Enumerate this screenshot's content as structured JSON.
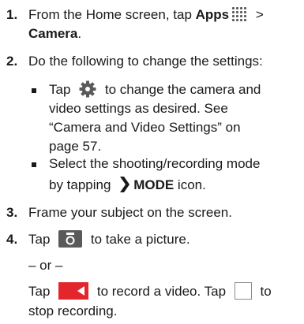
{
  "step1": {
    "number": "1.",
    "text_a": "From the Home screen, tap ",
    "apps": "Apps",
    "text_b": " >",
    "camera": "Camera",
    "text_c": "."
  },
  "step2": {
    "number": "2.",
    "text": "Do the following to change the settings:",
    "bullet1": {
      "text_a": "Tap ",
      "text_b": " to change the camera and",
      "line2": "video settings as desired. See",
      "line3": "“Camera and Video Settings” on",
      "line4": "page 57."
    },
    "bullet2": {
      "line1": "Select the shooting/recording mode",
      "text_a": "by tapping ",
      "mode": "MODE",
      "text_b": " icon."
    }
  },
  "step3": {
    "number": "3.",
    "text": "Frame your subject on the screen."
  },
  "step4": {
    "number": "4.",
    "text_a": "Tap ",
    "text_b": " to take a picture.",
    "or": "– or –",
    "video_a": "Tap ",
    "video_b": " to record a video. Tap ",
    "video_c": " to",
    "video_line2": "stop recording."
  },
  "icons": {
    "apps": "apps-grid-icon",
    "settings": "gear-icon",
    "mode": "chevron-right-icon",
    "camera": "camera-icon",
    "video": "video-camera-icon",
    "stop": "stop-square-icon"
  },
  "colors": {
    "text": "#1a1a1a",
    "icon_gray": "#5a5a5a",
    "video_red": "#e3262c"
  }
}
